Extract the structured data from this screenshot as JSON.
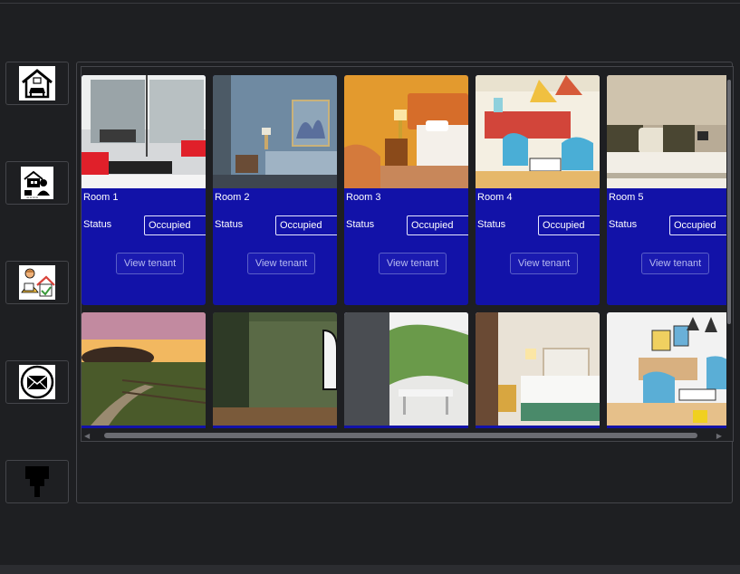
{
  "sidebar": {
    "items": [
      {
        "icon": "home-icon"
      },
      {
        "icon": "landlord-icon"
      },
      {
        "icon": "tenant-house-icon"
      },
      {
        "icon": "mail-icon"
      },
      {
        "icon": "paint-brush-icon"
      }
    ]
  },
  "rooms": [
    {
      "label": "Room 1",
      "status_label": "Status",
      "status_value": "Occupied",
      "button": "View tenant"
    },
    {
      "label": "Room 2",
      "status_label": "Status",
      "status_value": "Occupied",
      "button": "View tenant"
    },
    {
      "label": "Room 3",
      "status_label": "Status",
      "status_value": "Occupied",
      "button": "View tenant"
    },
    {
      "label": "Room 4",
      "status_label": "Status",
      "status_value": "Occupied",
      "button": "View tenant"
    },
    {
      "label": "Room 5",
      "status_label": "Status",
      "status_value": "Occupied",
      "button": "View tenant"
    }
  ],
  "colors": {
    "background": "#1e1f22",
    "card": "#1212a8",
    "border": "#45464b"
  }
}
